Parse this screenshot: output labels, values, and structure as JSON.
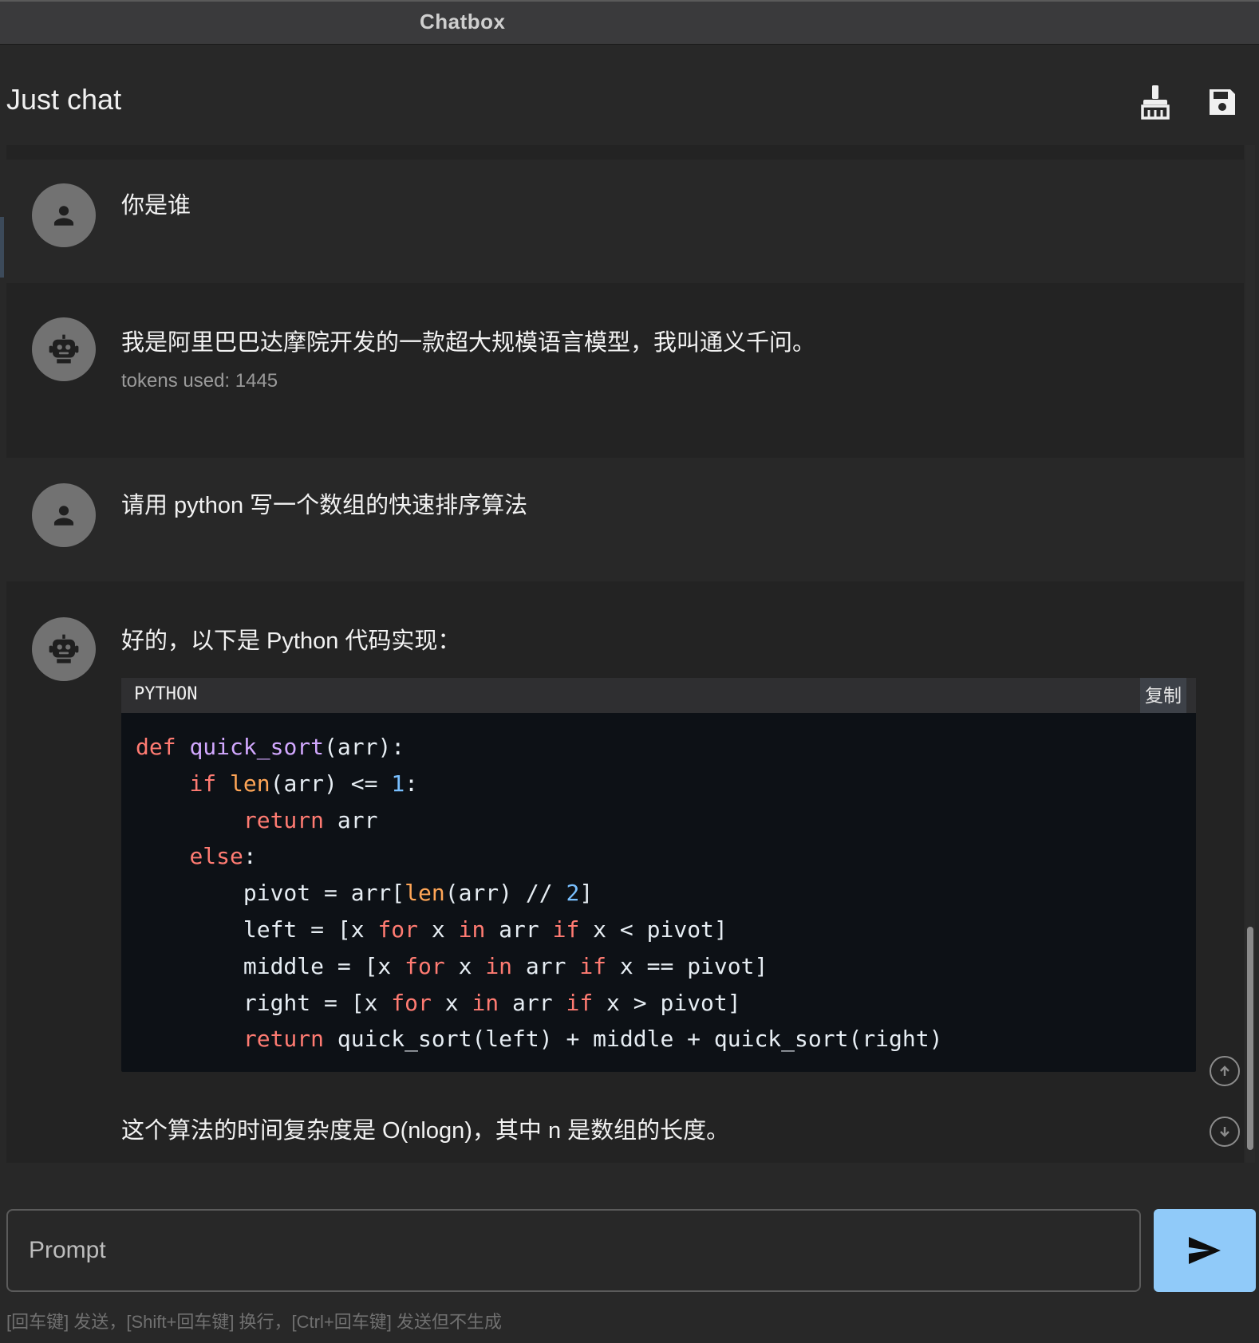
{
  "window": {
    "title": "Chatbox"
  },
  "header": {
    "chat_title": "Just chat",
    "clean_icon": "broom-icon",
    "save_icon": "floppy-disk-icon"
  },
  "messages": [
    {
      "role": "user",
      "avatar_icon": "person-icon",
      "text": "你是谁"
    },
    {
      "role": "assistant",
      "avatar_icon": "robot-icon",
      "text": "我是阿里巴巴达摩院开发的一款超大规模语言模型，我叫通义千问。",
      "meta": "tokens used: 1445"
    },
    {
      "role": "user",
      "avatar_icon": "person-icon",
      "text": "请用 python 写一个数组的快速排序算法"
    },
    {
      "role": "assistant",
      "avatar_icon": "robot-icon",
      "intro": "好的，以下是 Python 代码实现：",
      "code": {
        "language": "PYTHON",
        "copy_label": "复制",
        "lines": [
          [
            [
              "kw",
              "def"
            ],
            [
              "p",
              " "
            ],
            [
              "fn",
              "quick_sort"
            ],
            [
              "p",
              "(arr):"
            ]
          ],
          [
            [
              "p",
              "    "
            ],
            [
              "kw",
              "if"
            ],
            [
              "p",
              " "
            ],
            [
              "bi",
              "len"
            ],
            [
              "p",
              "(arr) <= "
            ],
            [
              "num",
              "1"
            ],
            [
              "p",
              ":"
            ]
          ],
          [
            [
              "p",
              "        "
            ],
            [
              "kw",
              "return"
            ],
            [
              "p",
              " arr"
            ]
          ],
          [
            [
              "p",
              "    "
            ],
            [
              "kw",
              "else"
            ],
            [
              "p",
              ":"
            ]
          ],
          [
            [
              "p",
              "        pivot = arr["
            ],
            [
              "bi",
              "len"
            ],
            [
              "p",
              "(arr) // "
            ],
            [
              "num",
              "2"
            ],
            [
              "p",
              "]"
            ]
          ],
          [
            [
              "p",
              "        left = [x "
            ],
            [
              "kw",
              "for"
            ],
            [
              "p",
              " x "
            ],
            [
              "kw",
              "in"
            ],
            [
              "p",
              " arr "
            ],
            [
              "kw",
              "if"
            ],
            [
              "p",
              " x < pivot]"
            ]
          ],
          [
            [
              "p",
              "        middle = [x "
            ],
            [
              "kw",
              "for"
            ],
            [
              "p",
              " x "
            ],
            [
              "kw",
              "in"
            ],
            [
              "p",
              " arr "
            ],
            [
              "kw",
              "if"
            ],
            [
              "p",
              " x == pivot]"
            ]
          ],
          [
            [
              "p",
              "        right = [x "
            ],
            [
              "kw",
              "for"
            ],
            [
              "p",
              " x "
            ],
            [
              "kw",
              "in"
            ],
            [
              "p",
              " arr "
            ],
            [
              "kw",
              "if"
            ],
            [
              "p",
              " x > pivot]"
            ]
          ],
          [
            [
              "p",
              "        "
            ],
            [
              "kw",
              "return"
            ],
            [
              "p",
              " quick_sort(left) + middle + quick_sort(right)"
            ]
          ]
        ]
      },
      "outro": "这个算法的时间复杂度是 O(nlogn)，其中 n 是数组的长度。"
    }
  ],
  "scroll_controls": {
    "up_icon": "arrow-up-circle-icon",
    "down_icon": "arrow-down-circle-icon"
  },
  "composer": {
    "placeholder": "Prompt",
    "value": "",
    "send_icon": "send-icon"
  },
  "hint": "[回车键] 发送，[Shift+回车键] 换行，[Ctrl+回车键] 发送但不生成",
  "colors": {
    "send_button": "#90caf9",
    "keyword": "#ff7b72",
    "function": "#d2a8ff",
    "builtin": "#ffa657",
    "number": "#79c0ff"
  }
}
